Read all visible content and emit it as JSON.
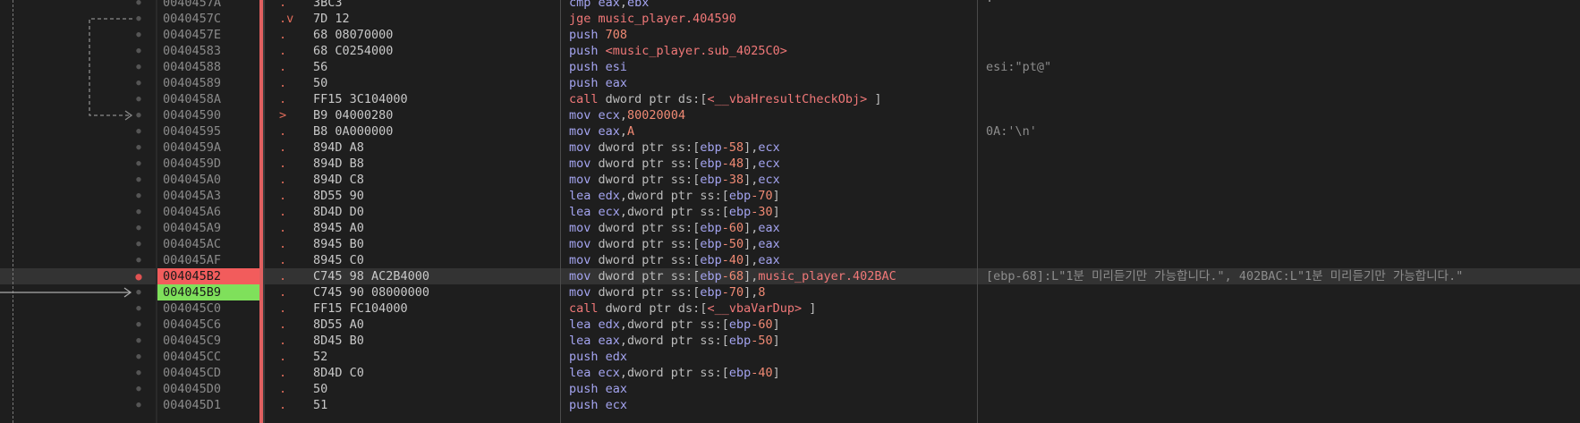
{
  "rows": [
    {
      "addr": "0040457A",
      "mark": ".",
      "bytes": "3BC3",
      "asm": [
        [
          "k-mnem",
          "cmp "
        ],
        [
          "k-reg",
          "eax"
        ],
        [
          "k-text",
          ","
        ],
        [
          "k-reg",
          "ebx"
        ]
      ],
      "comment": ""
    },
    {
      "addr": "0040457C",
      "mark": ".v",
      "bytes": "7D 12",
      "asm": [
        [
          "k-jump",
          "jge "
        ],
        [
          "k-sym",
          "music_player.404590"
        ]
      ],
      "comment": ""
    },
    {
      "addr": "0040457E",
      "mark": ".",
      "bytes": "68 08070000",
      "asm": [
        [
          "k-mnem",
          "push "
        ],
        [
          "k-num",
          "708"
        ]
      ],
      "comment": ""
    },
    {
      "addr": "00404583",
      "mark": ".",
      "bytes": "68 C0254000",
      "asm": [
        [
          "k-mnem",
          "push "
        ],
        [
          "k-sym",
          "<music_player.sub_4025C0>"
        ]
      ],
      "comment": ""
    },
    {
      "addr": "00404588",
      "mark": ".",
      "bytes": "56",
      "asm": [
        [
          "k-mnem",
          "push "
        ],
        [
          "k-reg",
          "esi"
        ]
      ],
      "comment": "esi:\"pt@\""
    },
    {
      "addr": "00404589",
      "mark": ".",
      "bytes": "50",
      "asm": [
        [
          "k-mnem",
          "push "
        ],
        [
          "k-reg",
          "eax"
        ]
      ],
      "comment": ""
    },
    {
      "addr": "0040458A",
      "mark": ".",
      "bytes": "FF15 3C104000",
      "asm": [
        [
          "k-call",
          "call "
        ],
        [
          "k-text",
          "dword ptr "
        ],
        [
          "k-seg",
          "ds:"
        ],
        [
          "k-text",
          "["
        ],
        [
          "k-sym",
          "<__vbaHresultCheckObj>"
        ],
        [
          "k-text",
          " ]"
        ]
      ],
      "comment": ""
    },
    {
      "addr": "00404590",
      "mark": ">",
      "bytes": "B9 04000280",
      "asm": [
        [
          "k-mnem",
          "mov "
        ],
        [
          "k-reg",
          "ecx"
        ],
        [
          "k-text",
          ","
        ],
        [
          "k-num",
          "80020004"
        ]
      ],
      "comment": ""
    },
    {
      "addr": "00404595",
      "mark": ".",
      "bytes": "B8 0A000000",
      "asm": [
        [
          "k-mnem",
          "mov "
        ],
        [
          "k-reg",
          "eax"
        ],
        [
          "k-text",
          ","
        ],
        [
          "k-num",
          "A"
        ]
      ],
      "comment": "0A:'\\n'"
    },
    {
      "addr": "0040459A",
      "mark": ".",
      "bytes": "894D A8",
      "asm": [
        [
          "k-mnem",
          "mov "
        ],
        [
          "k-text",
          "dword ptr "
        ],
        [
          "k-seg",
          "ss:"
        ],
        [
          "k-text",
          "["
        ],
        [
          "k-reg",
          "ebp"
        ],
        [
          "k-num",
          "-58"
        ],
        [
          "k-text",
          "],"
        ],
        [
          "k-reg",
          "ecx"
        ]
      ],
      "comment": ""
    },
    {
      "addr": "0040459D",
      "mark": ".",
      "bytes": "894D B8",
      "asm": [
        [
          "k-mnem",
          "mov "
        ],
        [
          "k-text",
          "dword ptr "
        ],
        [
          "k-seg",
          "ss:"
        ],
        [
          "k-text",
          "["
        ],
        [
          "k-reg",
          "ebp"
        ],
        [
          "k-num",
          "-48"
        ],
        [
          "k-text",
          "],"
        ],
        [
          "k-reg",
          "ecx"
        ]
      ],
      "comment": ""
    },
    {
      "addr": "004045A0",
      "mark": ".",
      "bytes": "894D C8",
      "asm": [
        [
          "k-mnem",
          "mov "
        ],
        [
          "k-text",
          "dword ptr "
        ],
        [
          "k-seg",
          "ss:"
        ],
        [
          "k-text",
          "["
        ],
        [
          "k-reg",
          "ebp"
        ],
        [
          "k-num",
          "-38"
        ],
        [
          "k-text",
          "],"
        ],
        [
          "k-reg",
          "ecx"
        ]
      ],
      "comment": ""
    },
    {
      "addr": "004045A3",
      "mark": ".",
      "bytes": "8D55 90",
      "asm": [
        [
          "k-mnem",
          "lea "
        ],
        [
          "k-reg",
          "edx"
        ],
        [
          "k-text",
          ",dword ptr "
        ],
        [
          "k-seg",
          "ss:"
        ],
        [
          "k-text",
          "["
        ],
        [
          "k-reg",
          "ebp"
        ],
        [
          "k-num",
          "-70"
        ],
        [
          "k-text",
          "]"
        ]
      ],
      "comment": ""
    },
    {
      "addr": "004045A6",
      "mark": ".",
      "bytes": "8D4D D0",
      "asm": [
        [
          "k-mnem",
          "lea "
        ],
        [
          "k-reg",
          "ecx"
        ],
        [
          "k-text",
          ",dword ptr "
        ],
        [
          "k-seg",
          "ss:"
        ],
        [
          "k-text",
          "["
        ],
        [
          "k-reg",
          "ebp"
        ],
        [
          "k-num",
          "-30"
        ],
        [
          "k-text",
          "]"
        ]
      ],
      "comment": ""
    },
    {
      "addr": "004045A9",
      "mark": ".",
      "bytes": "8945 A0",
      "asm": [
        [
          "k-mnem",
          "mov "
        ],
        [
          "k-text",
          "dword ptr "
        ],
        [
          "k-seg",
          "ss:"
        ],
        [
          "k-text",
          "["
        ],
        [
          "k-reg",
          "ebp"
        ],
        [
          "k-num",
          "-60"
        ],
        [
          "k-text",
          "],"
        ],
        [
          "k-reg",
          "eax"
        ]
      ],
      "comment": ""
    },
    {
      "addr": "004045AC",
      "mark": ".",
      "bytes": "8945 B0",
      "asm": [
        [
          "k-mnem",
          "mov "
        ],
        [
          "k-text",
          "dword ptr "
        ],
        [
          "k-seg",
          "ss:"
        ],
        [
          "k-text",
          "["
        ],
        [
          "k-reg",
          "ebp"
        ],
        [
          "k-num",
          "-50"
        ],
        [
          "k-text",
          "],"
        ],
        [
          "k-reg",
          "eax"
        ]
      ],
      "comment": ""
    },
    {
      "addr": "004045AF",
      "mark": ".",
      "bytes": "8945 C0",
      "asm": [
        [
          "k-mnem",
          "mov "
        ],
        [
          "k-text",
          "dword ptr "
        ],
        [
          "k-seg",
          "ss:"
        ],
        [
          "k-text",
          "["
        ],
        [
          "k-reg",
          "ebp"
        ],
        [
          "k-num",
          "-40"
        ],
        [
          "k-text",
          "],"
        ],
        [
          "k-reg",
          "eax"
        ]
      ],
      "comment": ""
    },
    {
      "addr": "004045B2",
      "mark": ".",
      "bytes": "C745 98 AC2B4000",
      "asm": [
        [
          "k-mnem",
          "mov "
        ],
        [
          "k-text",
          "dword ptr "
        ],
        [
          "k-seg",
          "ss:"
        ],
        [
          "k-text",
          "["
        ],
        [
          "k-reg",
          "ebp"
        ],
        [
          "k-num",
          "-68"
        ],
        [
          "k-text",
          "],"
        ],
        [
          "k-sym",
          "music_player.402BAC"
        ]
      ],
      "comment": "[ebp-68]:L\"1분 미리듣기만 가능합니다.\", 402BAC:L\"1분 미리듣기만 가능합니다.\"",
      "breakpoint": true,
      "highlight": true
    },
    {
      "addr": "004045B9",
      "mark": ".",
      "bytes": "C745 90 08000000",
      "asm": [
        [
          "k-mnem",
          "mov "
        ],
        [
          "k-text",
          "dword ptr "
        ],
        [
          "k-seg",
          "ss:"
        ],
        [
          "k-text",
          "["
        ],
        [
          "k-reg",
          "ebp"
        ],
        [
          "k-num",
          "-70"
        ],
        [
          "k-text",
          "],"
        ],
        [
          "k-num",
          "8"
        ]
      ],
      "comment": "",
      "eip": true
    },
    {
      "addr": "004045C0",
      "mark": ".",
      "bytes": "FF15 FC104000",
      "asm": [
        [
          "k-call",
          "call "
        ],
        [
          "k-text",
          "dword ptr "
        ],
        [
          "k-seg",
          "ds:"
        ],
        [
          "k-text",
          "["
        ],
        [
          "k-sym",
          "<__vbaVarDup>"
        ],
        [
          "k-text",
          " ]"
        ]
      ],
      "comment": ""
    },
    {
      "addr": "004045C6",
      "mark": ".",
      "bytes": "8D55 A0",
      "asm": [
        [
          "k-mnem",
          "lea "
        ],
        [
          "k-reg",
          "edx"
        ],
        [
          "k-text",
          ",dword ptr "
        ],
        [
          "k-seg",
          "ss:"
        ],
        [
          "k-text",
          "["
        ],
        [
          "k-reg",
          "ebp"
        ],
        [
          "k-num",
          "-60"
        ],
        [
          "k-text",
          "]"
        ]
      ],
      "comment": ""
    },
    {
      "addr": "004045C9",
      "mark": ".",
      "bytes": "8D45 B0",
      "asm": [
        [
          "k-mnem",
          "lea "
        ],
        [
          "k-reg",
          "eax"
        ],
        [
          "k-text",
          ",dword ptr "
        ],
        [
          "k-seg",
          "ss:"
        ],
        [
          "k-text",
          "["
        ],
        [
          "k-reg",
          "ebp"
        ],
        [
          "k-num",
          "-50"
        ],
        [
          "k-text",
          "]"
        ]
      ],
      "comment": ""
    },
    {
      "addr": "004045CC",
      "mark": ".",
      "bytes": "52",
      "asm": [
        [
          "k-mnem",
          "push "
        ],
        [
          "k-reg",
          "edx"
        ]
      ],
      "comment": ""
    },
    {
      "addr": "004045CD",
      "mark": ".",
      "bytes": "8D4D C0",
      "asm": [
        [
          "k-mnem",
          "lea "
        ],
        [
          "k-reg",
          "ecx"
        ],
        [
          "k-text",
          ",dword ptr "
        ],
        [
          "k-seg",
          "ss:"
        ],
        [
          "k-text",
          "["
        ],
        [
          "k-reg",
          "ebp"
        ],
        [
          "k-num",
          "-40"
        ],
        [
          "k-text",
          "]"
        ]
      ],
      "comment": ""
    },
    {
      "addr": "004045D0",
      "mark": ".",
      "bytes": "50",
      "asm": [
        [
          "k-mnem",
          "push "
        ],
        [
          "k-reg",
          "eax"
        ]
      ],
      "comment": ""
    },
    {
      "addr": "004045D1",
      "mark": ".",
      "bytes": "51",
      "asm": [
        [
          "k-mnem",
          "push "
        ],
        [
          "k-reg",
          "ecx"
        ]
      ],
      "comment": ""
    }
  ],
  "top_comment_fragment": ": \""
}
